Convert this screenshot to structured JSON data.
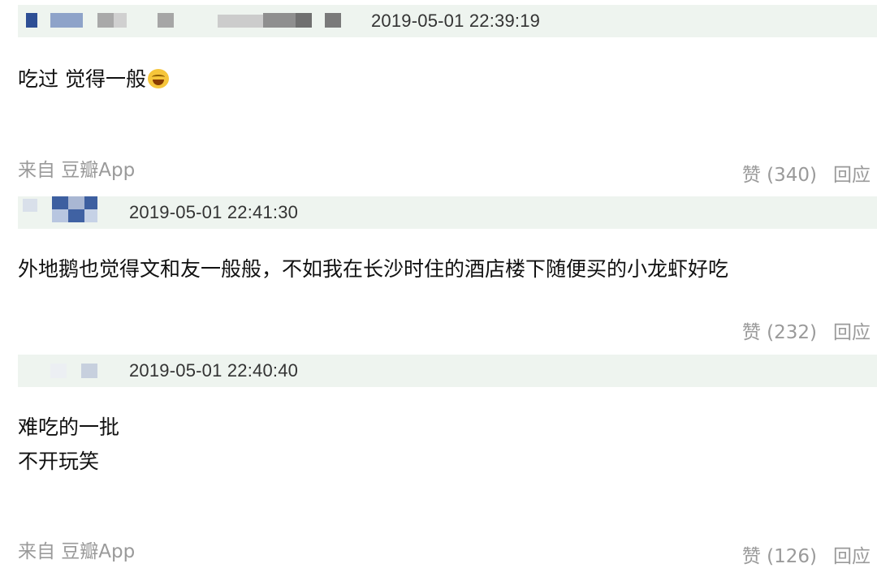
{
  "comments": [
    {
      "timestamp": "2019-05-01 22:39:19",
      "lines": [
        "吃过 觉得一般"
      ],
      "emoji": "tears-of-joy-emoji",
      "source": "来自 豆瓣App",
      "like_label": "赞 (340)",
      "reply_label": "回应"
    },
    {
      "timestamp": "2019-05-01 22:41:30",
      "lines": [
        "外地鹅也觉得文和友一般般，不如我在长沙时住的酒店楼下随便买的小龙虾好吃"
      ],
      "source": "",
      "like_label": "赞 (232)",
      "reply_label": "回应"
    },
    {
      "timestamp": "2019-05-01 22:40:40",
      "lines": [
        "难吃的一批",
        "不开玩笑"
      ],
      "source": "来自 豆瓣App",
      "like_label": "赞 (126)",
      "reply_label": "回应"
    }
  ],
  "colors": {
    "header_bg": "#eef4ef",
    "meta_text": "#9a9a9a",
    "avatar_blue": "#3d5fa0"
  }
}
